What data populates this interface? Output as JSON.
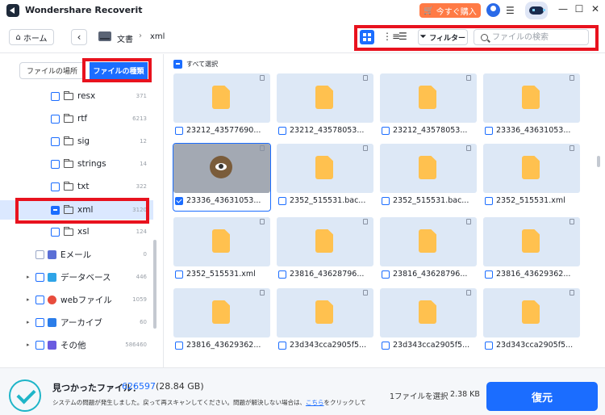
{
  "app": {
    "title": "Wondershare Recoverit",
    "buy_label": "今すぐ購入"
  },
  "toolbar": {
    "home_label": "ホーム",
    "breadcrumb": [
      "文書",
      "xml"
    ],
    "filter_label": "フィルター",
    "search_placeholder": "ファイルの検索"
  },
  "sidebar": {
    "tabs": [
      "ファイルの場所",
      "ファイルの種類"
    ],
    "items": [
      {
        "label": "resx",
        "count": "371"
      },
      {
        "label": "rtf",
        "count": "6213"
      },
      {
        "label": "sig",
        "count": "12"
      },
      {
        "label": "strings",
        "count": "14"
      },
      {
        "label": "txt",
        "count": "322"
      },
      {
        "label": "xml",
        "count": "3120"
      },
      {
        "label": "xsl",
        "count": "124"
      }
    ],
    "categories": [
      {
        "label": "Eメール",
        "count": "0",
        "color": "#5b6fd6"
      },
      {
        "label": "データベース",
        "count": "446",
        "color": "#2fa4e7"
      },
      {
        "label": "webファイル",
        "count": "1059",
        "color": "#e84c3d"
      },
      {
        "label": "アーカイブ",
        "count": "60",
        "color": "#2b7de9"
      },
      {
        "label": "その他",
        "count": "586460",
        "color": "#6a5be0"
      }
    ]
  },
  "grid": {
    "select_all_label": "すべて選択",
    "files": [
      "23212_43577690...",
      "23212_43578053...",
      "23212_43578053...",
      "23336_43631053...",
      "23336_43631053...",
      "2352_515531.bac...",
      "2352_515531.bac...",
      "2352_515531.xml",
      "2352_515531.xml",
      "23816_43628796...",
      "23816_43628796...",
      "23816_43629362...",
      "23816_43629362...",
      "23d343cca2905f5...",
      "23d343cca2905f5...",
      "23d343cca2905f5..."
    ]
  },
  "bottom": {
    "found_label": "見つかったファイル：",
    "found_count": "626597",
    "found_size": "(28.84 GB)",
    "message_pre": "システムの問題が発生しました。戻って再スキャンしてください。問題が解決しない場合は、",
    "message_link": "こちら",
    "message_post": "をクリックして",
    "selected_info": "1ファイルを選択",
    "selected_size": "2.38 KB",
    "recover_label": "復元"
  }
}
